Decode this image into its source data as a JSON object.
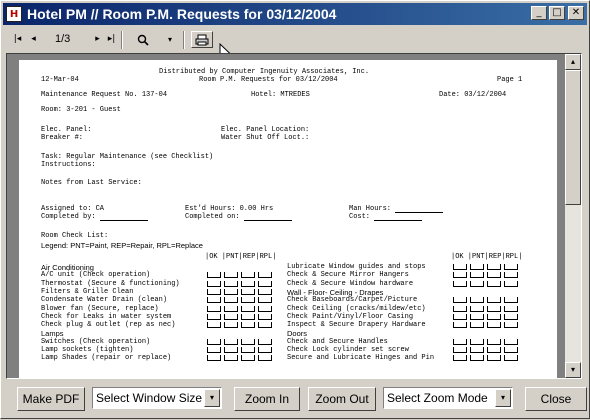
{
  "window": {
    "title": "Hotel PM // Room P.M. Requests for 03/12/2004",
    "app_icon_glyph": "H"
  },
  "titlebar_buttons": {
    "minimize": "_",
    "maximize": "□",
    "close": "✕"
  },
  "toolbar": {
    "first": "|◂",
    "prev": "◂",
    "page": "1/3",
    "next": "▸",
    "last": "▸|",
    "search": "🔍",
    "dropdown": "▾",
    "print": "🖨"
  },
  "report": {
    "distributed_by": "Distributed by Computer Ingenuity Associates, Inc.",
    "date": "12-Mar-04",
    "title": "Room P.M. Requests for 03/12/2004",
    "page_label": "Page 1",
    "request_no": "Maintenance Request No. 137-04",
    "hotel": "Hotel: MTREDES",
    "request_date": "Date: 03/12/2004",
    "room": "Room:  3-201 - Guest",
    "elec_panel": "Elec. Panel:",
    "elec_panel_location": "Elec. Panel Location:",
    "breaker": "Breaker #:",
    "water_shutoff": "Water Shut Off Loct.:",
    "task": "Task: Regular Maintenance (see Checklist)",
    "instructions": "Instructions:",
    "notes": "Notes from Last Service:",
    "assigned_to": "Assigned to: CA",
    "est_hours": "Est'd Hours: 0.00 Hrs",
    "man_hours": "Man Hours:",
    "completed_by": "Completed by:",
    "completed_on": "Completed on:",
    "cost": "Cost:",
    "room_checklist": "Room Check List:",
    "legend": "Legend: PNT=Paint, REP=Repair, RPL=Replace",
    "col_headers": "|OK |PNT|REP|RPL|",
    "left_items": [
      {
        "text": "Air Conditioning",
        "header": true
      },
      {
        "text": "A/C unit (Check operation)"
      },
      {
        "text": "Thermostat (Secure & functioning)"
      },
      {
        "text": "Filters & Grille Clean"
      },
      {
        "text": "Condensate Water Drain (clean)"
      },
      {
        "text": "Blower fan (Secure, replace)"
      },
      {
        "text": "Check for Leaks in water system"
      },
      {
        "text": "Check plug & outlet (rep as nec)"
      },
      {
        "text": "Lamps",
        "header": true
      },
      {
        "text": "Switches (Check operation)"
      },
      {
        "text": "Lamp sockets (tighten)"
      },
      {
        "text": "Lamp Shades (repair or replace)"
      }
    ],
    "right_items": [
      {
        "text": "Lubricate Window guides and stops"
      },
      {
        "text": "Check & Secure Mirror Hangers"
      },
      {
        "text": "Check & Secure Window hardware"
      },
      {
        "text": "Wall - Floor- Ceiling - Drapes",
        "header": true
      },
      {
        "text": "Check Baseboards/Carpet/Picture"
      },
      {
        "text": "Check Ceiling (cracks/mildew/etc)"
      },
      {
        "text": "Check Paint/Vinyl/Floor Casing"
      },
      {
        "text": "Inspect & Secure Drapery Hardware"
      },
      {
        "text": "Doors",
        "header": true
      },
      {
        "text": "Check and Secure Handles"
      },
      {
        "text": "Check Lock cylinder set screw"
      },
      {
        "text": "Secure and Lubricate Hinges and Pin"
      }
    ]
  },
  "bottom": {
    "make_pdf": "Make PDF",
    "window_size": "Select Window Size",
    "zoom_in": "Zoom In",
    "zoom_out": "Zoom Out",
    "zoom_mode": "Select Zoom Mode",
    "close": "Close"
  }
}
